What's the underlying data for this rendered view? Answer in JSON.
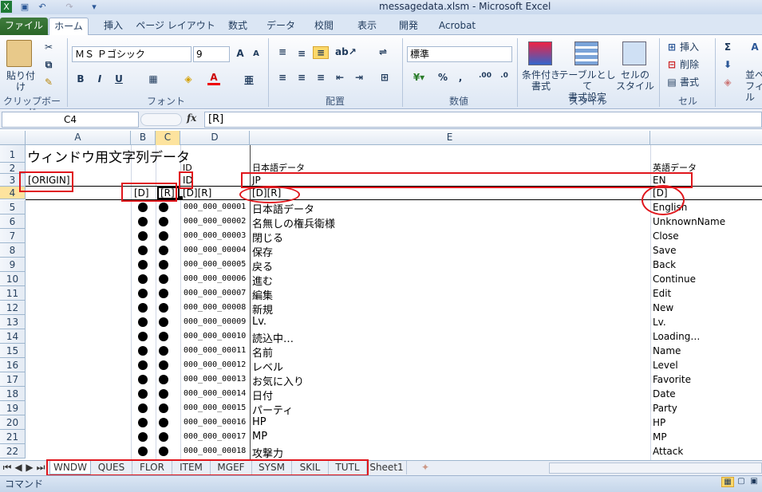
{
  "window": {
    "title": "messagedata.xlsm - Microsoft Excel"
  },
  "ribbon": {
    "tabs": [
      "ファイル",
      "ホーム",
      "挿入",
      "ページ レイアウト",
      "数式",
      "データ",
      "校閲",
      "表示",
      "開発",
      "Acrobat"
    ],
    "clipboard": {
      "paste": "貼り付け",
      "label": "クリップボード"
    },
    "font": {
      "name": "ＭＳ Ｐゴシック",
      "size": "9",
      "label": "フォント"
    },
    "alignment": {
      "label": "配置"
    },
    "number": {
      "format": "標準",
      "label": "数値"
    },
    "styles": {
      "conditional": "条件付き\n書式",
      "table": "テーブルとして\n書式設定",
      "cell": "セルの\nスタイル",
      "label": "スタイル"
    },
    "cells": {
      "insert": "挿入",
      "delete": "削除",
      "format": "書式",
      "label": "セル"
    },
    "editing": {
      "sort": "並べ",
      "fill": "フィル"
    }
  },
  "formula": {
    "namebox": "C4",
    "fx": "fx",
    "value": "[R]"
  },
  "columns": [
    "A",
    "B",
    "C",
    "D",
    "E"
  ],
  "rows": {
    "r1": {
      "a": "ウィンドウ用文字列データ"
    },
    "r2": {
      "d": "ID",
      "e": "日本語データ",
      "f": "英語データ"
    },
    "r3": {
      "a": "[ORIGIN]",
      "d": "ID",
      "e": "JP",
      "f": "EN"
    },
    "r4": {
      "b": "[D]",
      "c": "[R]",
      "d": "[D][R]",
      "e": "[D][R]",
      "f": "[D]"
    },
    "data": [
      {
        "n": "5",
        "id": "000_000_00001",
        "jp": "日本語データ",
        "en": "English"
      },
      {
        "n": "6",
        "id": "000_000_00002",
        "jp": "名無しの権兵衛様",
        "en": "UnknownName"
      },
      {
        "n": "7",
        "id": "000_000_00003",
        "jp": "閉じる",
        "en": "Close"
      },
      {
        "n": "8",
        "id": "000_000_00004",
        "jp": "保存",
        "en": "Save"
      },
      {
        "n": "9",
        "id": "000_000_00005",
        "jp": "戻る",
        "en": "Back"
      },
      {
        "n": "10",
        "id": "000_000_00006",
        "jp": "進む",
        "en": "Continue"
      },
      {
        "n": "11",
        "id": "000_000_00007",
        "jp": "編集",
        "en": "Edit"
      },
      {
        "n": "12",
        "id": "000_000_00008",
        "jp": "新規",
        "en": "New"
      },
      {
        "n": "13",
        "id": "000_000_00009",
        "jp": "Lv.",
        "en": "Lv."
      },
      {
        "n": "14",
        "id": "000_000_00010",
        "jp": "読込中…",
        "en": "Loading…"
      },
      {
        "n": "15",
        "id": "000_000_00011",
        "jp": "名前",
        "en": "Name"
      },
      {
        "n": "16",
        "id": "000_000_00012",
        "jp": "レベル",
        "en": "Level"
      },
      {
        "n": "17",
        "id": "000_000_00013",
        "jp": "お気に入り",
        "en": "Favorite"
      },
      {
        "n": "18",
        "id": "000_000_00014",
        "jp": "日付",
        "en": "Date"
      },
      {
        "n": "19",
        "id": "000_000_00015",
        "jp": "パーティ",
        "en": "Party"
      },
      {
        "n": "20",
        "id": "000_000_00016",
        "jp": "HP",
        "en": "HP"
      },
      {
        "n": "21",
        "id": "000_000_00017",
        "jp": "MP",
        "en": "MP"
      },
      {
        "n": "22",
        "id": "000_000_00018",
        "jp": "攻撃力",
        "en": "Attack"
      }
    ]
  },
  "sheets": [
    "WNDW",
    "QUES",
    "FLOR",
    "ITEM",
    "MGEF",
    "SYSM",
    "SKIL",
    "TUTL",
    "Sheet1"
  ],
  "status": {
    "mode": "コマンド"
  },
  "colors": {
    "accent": "#2a6628",
    "annotation": "#e0161c"
  }
}
